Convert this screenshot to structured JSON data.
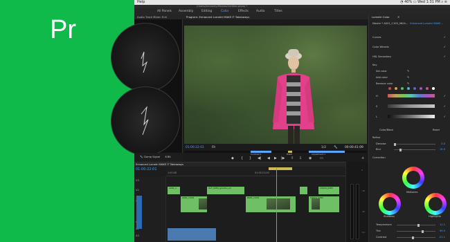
{
  "brand": {
    "logo_text": "Pr",
    "bg_color": "#0fba4a"
  },
  "menubar": {
    "help": "Help",
    "battery": "40%",
    "clock": "Wed 1:31 PM"
  },
  "title_bar": {
    "path": "/Users/jarrouvey/Movies/Untitled.prproj *"
  },
  "workspaces": [
    "All Panels",
    "Assembly",
    "Editing",
    "Color",
    "Effects",
    "Audio",
    "Titles"
  ],
  "scopes": {
    "header": "Audio Track Mixer: Enh",
    "footer": "Clamp Signal",
    "bit": "8 Bit"
  },
  "program": {
    "header": "Program: Enhanced Lumetri MAKE IT Takeaways",
    "timecode_in": "01:00:22:01",
    "fit": "Fit",
    "quality": "1/2",
    "timecode_out": "00:00:41:09",
    "markers": [
      "Contrast 1",
      "Track",
      "Adjustment 1"
    ]
  },
  "lumetri": {
    "header": "Lumetri Color",
    "source": "Master * A001_C109_0604...",
    "clip": "Enhanced Lumetri MAKE...",
    "sections": [
      "Curves",
      "Color Wheels",
      "HSL Secondary"
    ],
    "key_label": "Key",
    "set_color": "Set color",
    "add_color": "Add color",
    "remove_color": "Remove color",
    "h": "H",
    "s": "S",
    "l": "L",
    "color_gray": "Color/Black",
    "reset": "Reset",
    "refine": "Refine",
    "denoise": "Denoise",
    "denoise_val": "0.0",
    "blur": "Blur",
    "blur_val": "15.0",
    "correction": "Correction",
    "midtones": "Midtones",
    "shadows": "Shadows",
    "highlights": "Highlights",
    "temperature": "Temperature",
    "temperature_val": "11.1",
    "tint": "Tint",
    "tint_val": "99.0",
    "contrast": "Contrast",
    "contrast_val": "-21.1",
    "swatch_colors": [
      "#c94848",
      "#d1a23d",
      "#5fbf4f",
      "#4cb7c4",
      "#4c6ad1",
      "#a04fd1",
      "#d14f9e",
      "#ffffff"
    ]
  },
  "timeline": {
    "header": "Enhanced Lumetri MAKE IT Takeaways",
    "timecode": "01:00:22:01",
    "ruler_ticks": [
      "1:00:08",
      "01:00:21:00"
    ],
    "track_labels": [
      "V3",
      "V2",
      "V1",
      "A1",
      "A2",
      "A3"
    ],
    "clips": [
      "A001_C",
      "DLF_0284_goodbu_sh",
      "A001_C109",
      "C0016_0283",
      "B001_C109",
      "C0016_0283",
      "Enhanced",
      "A001_C109_0604"
    ]
  }
}
